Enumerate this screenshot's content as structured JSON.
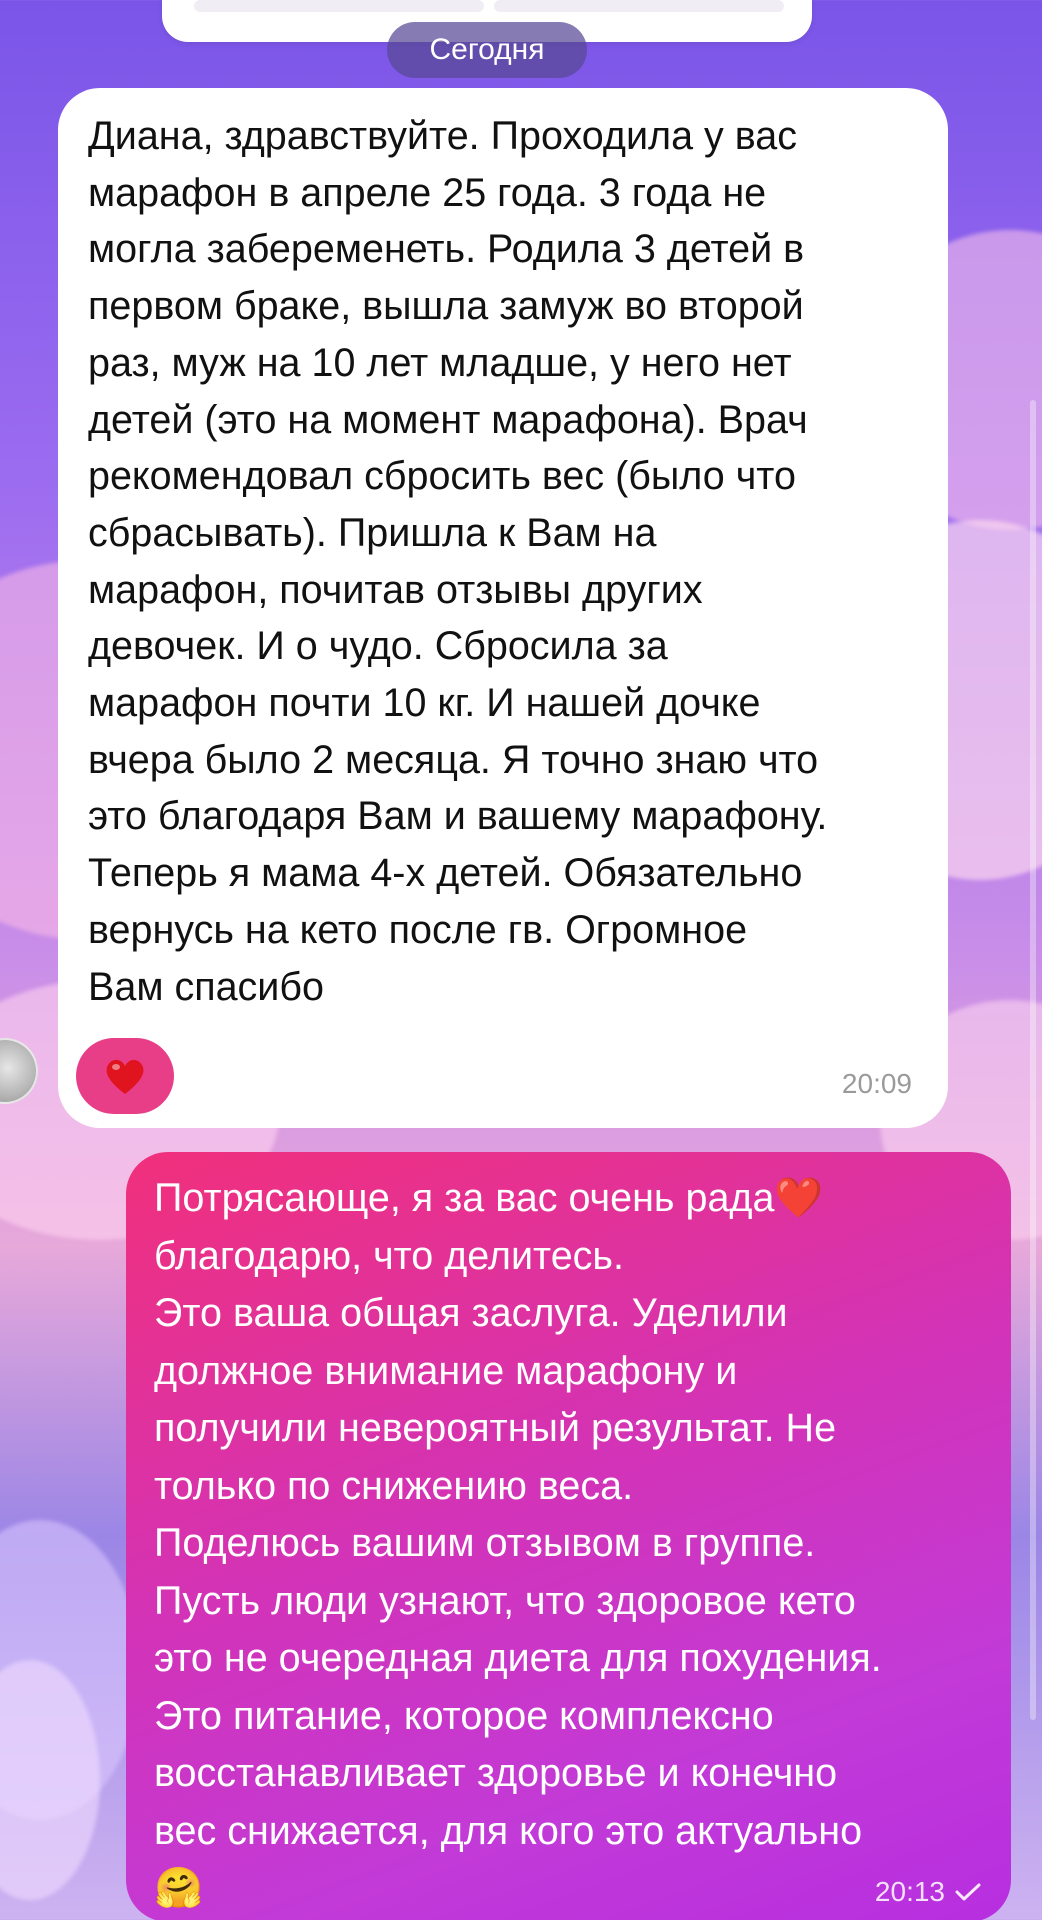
{
  "date_divider": "Сегодня",
  "incoming": {
    "text": "Диана, здравствуйте. Проходила у вас\nмарафон в апреле 25 года. 3 года не\nмогла забеременеть. Родила 3 детей в\nпервом браке, вышла замуж во второй\nраз, муж на 10 лет младше, у него нет\nдетей (это на момент марафона). Врач\nрекомендовал сбросить вес (было что\nсбрасывать). Пришла к Вам на\nмарафон, почитав отзывы других\nдевочек. И о чудо. Сбросила за\nмарафон почти 10 кг. И нашей дочке\nвчера было 2 месяца. Я точно знаю что\nэто благодаря Вам и вашему марафону.\nТеперь я мама 4-х детей. Обязательно\nвернусь на кето после гв. Огромное\nВам спасибо",
    "time": "20:09",
    "reaction_icon": "red-heart"
  },
  "outgoing": {
    "text": "Потрясающе, я за вас очень рада❤️\nблагодарю, что делитесь.\nЭто ваша общая заслуга. Уделили\nдолжное внимание марафону и\nполучили невероятный результат. Не\nтолько по снижению веса.\nПоделюсь вашим отзывом в группе.\nПусть люди узнают, что здоровое кето\nэто не очередная диета для похудения.\nЭто питание, которое комплексно\nвосстанавливает здоровье и конечно\nвес снижается, для кого это актуально\n🤗",
    "time": "20:13",
    "status_icon": "sent-check"
  },
  "colors": {
    "reaction_bg": "#e83e88",
    "outgoing_start": "#f1307b",
    "outgoing_end": "#b72ee0",
    "date_pill": "#584894"
  }
}
